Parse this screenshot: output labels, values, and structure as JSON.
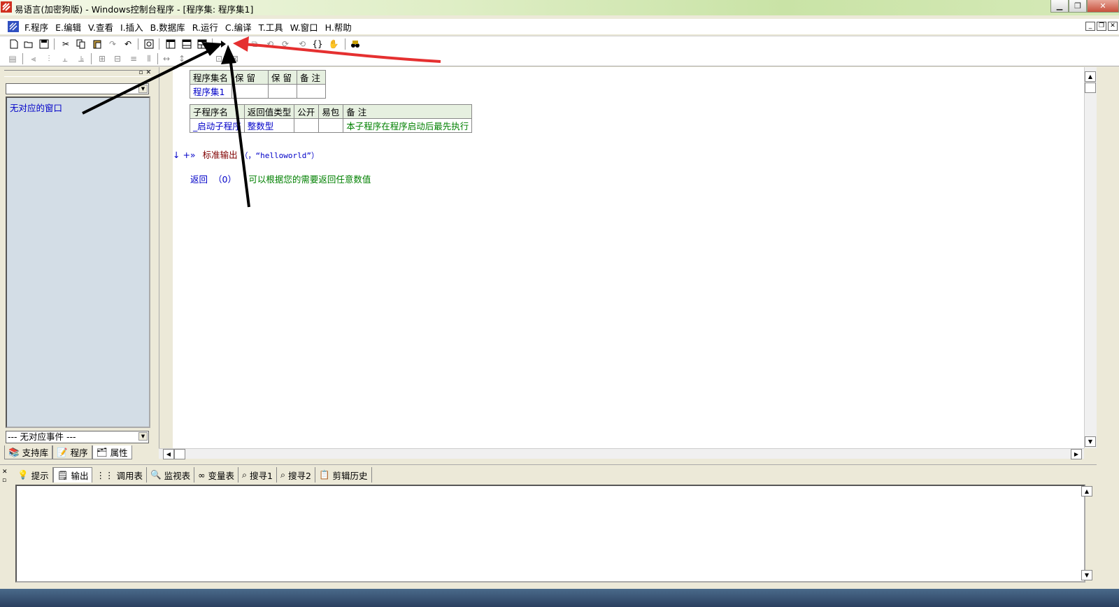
{
  "window": {
    "title": "易语言(加密狗版) - Windows控制台程序 - [程序集: 程序集1]"
  },
  "menu": {
    "items": [
      "F.程序",
      "E.编辑",
      "V.查看",
      "I.插入",
      "B.数据库",
      "R.运行",
      "C.编译",
      "T.工具",
      "W.窗口",
      "H.帮助"
    ]
  },
  "toolbar": {
    "icons": [
      "new-file-icon",
      "open-folder-icon",
      "save-icon",
      "cut-icon",
      "copy-icon",
      "paste-icon",
      "redo-icon",
      "undo-icon",
      "find-icon",
      "layout-1-icon",
      "layout-2-icon",
      "layout-3-icon",
      "run-icon",
      "hand-icon",
      "debug-icon"
    ]
  },
  "left_panel": {
    "window_list_item": "无对应的窗口",
    "event_combo_value": "--- 无对应事件 ---",
    "tabs": [
      "支持库",
      "程序",
      "属性"
    ]
  },
  "editor": {
    "assembly_table": {
      "headers": [
        "程序集名",
        "保 留",
        "保 留",
        "备 注"
      ],
      "row": [
        "程序集1",
        "",
        "",
        ""
      ]
    },
    "sub_table": {
      "headers": [
        "子程序名",
        "返回值类型",
        "公开",
        "易包",
        "备 注"
      ],
      "row": [
        "_启动子程序",
        "整数型",
        "",
        "",
        "本子程序在程序启动后最先执行"
      ]
    },
    "code": {
      "marker": "↓ +»",
      "line1_func": "标准输出",
      "line1_args": "（，“helloworld”）",
      "line2_kw": "返回",
      "line2_args": "（0）",
      "line2_comment": "' 可以根据您的需要返回任意数值"
    }
  },
  "bottom_panel": {
    "tabs": [
      "提示",
      "输出",
      "调用表",
      "监视表",
      "变量表",
      "搜寻1",
      "搜寻2",
      "剪辑历史"
    ]
  },
  "colors": {
    "annotation_black": "#000000",
    "annotation_red": "#e53030",
    "keyword_blue": "#0000c8",
    "comment_green": "#008000",
    "function_maroon": "#800000"
  }
}
